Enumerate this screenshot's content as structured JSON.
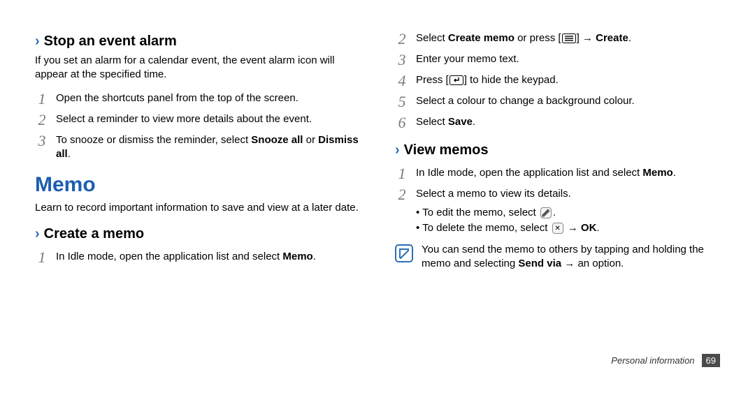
{
  "left": {
    "heading_stop": "Stop an event alarm",
    "stop_intro": "If you set an alarm for a calendar event, the event alarm icon will appear at the specified time.",
    "stop_steps": [
      "Open the shortcuts panel from the top of the screen.",
      "Select a reminder to view more details about the event.",
      "To snooze or dismiss the reminder, select <b>Snooze all</b> or <b>Dismiss all</b>."
    ],
    "section_memo": "Memo",
    "memo_intro": "Learn to record important information to save and view at a later date.",
    "heading_create": "Create a memo",
    "create_step_1": "In Idle mode, open the application list and select <b>Memo</b>."
  },
  "right": {
    "create_step_2a": "Select <b>Create memo</b> or press [",
    "create_step_2b": "] → <b>Create</b>.",
    "create_step_3": "Enter your memo text.",
    "create_step_4a": "Press [",
    "create_step_4b": "] to hide the keypad.",
    "create_step_5": "Select a colour to change a background colour.",
    "create_step_6": "Select <b>Save</b>.",
    "heading_view": "View memos",
    "view_step_1": "In Idle mode, open the application list and select <b>Memo</b>.",
    "view_step_2": "Select a memo to view its details.",
    "bullet_edit_a": "• To edit the memo, select ",
    "bullet_delete_a": "• To delete the memo, select ",
    "bullet_delete_b": " → <b>OK</b>.",
    "note": "You can send the memo to others by tapping and holding the memo and selecting <b>Send via</b> → an option."
  },
  "footer": {
    "section": "Personal information",
    "page": "69"
  }
}
